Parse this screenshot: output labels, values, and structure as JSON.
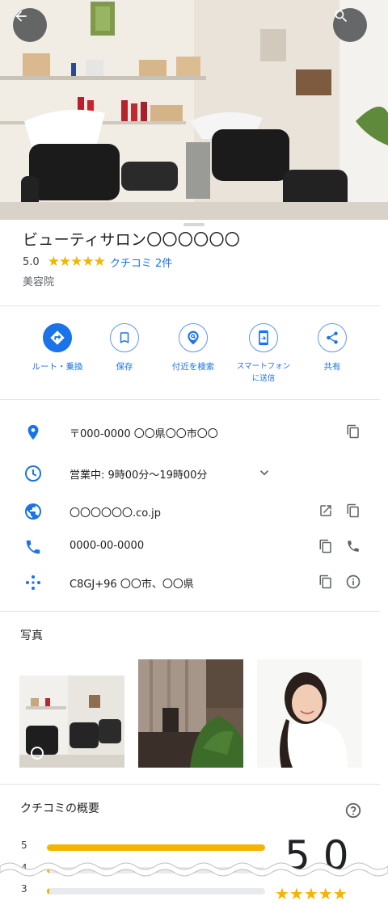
{
  "place": {
    "name": "ビューティサロン〇〇〇〇〇〇",
    "rating": "5.0",
    "stars": "★★★★★",
    "review_link": "クチコミ 2件",
    "category": "美容院"
  },
  "actions": [
    {
      "label": "ルート・乗換",
      "icon": "directions-icon"
    },
    {
      "label": "保存",
      "icon": "bookmark-icon"
    },
    {
      "label": "付近を検索",
      "icon": "nearby-search-icon"
    },
    {
      "label": "スマートフォン\nに送信",
      "icon": "send-to-phone-icon"
    },
    {
      "label": "共有",
      "icon": "share-icon"
    }
  ],
  "info": {
    "address": "〒000-0000 〇〇県〇〇市〇〇",
    "hours": "営業中:  9時00分～19時00分",
    "website": "〇〇〇〇〇〇.co.jp",
    "phone": "0000-00-0000",
    "plus_code": "C8GJ+96 〇〇市、〇〇県"
  },
  "photos": {
    "title": "写真"
  },
  "reviews": {
    "title": "クチコミの概要",
    "score": "5.0",
    "stars": "★★★★★",
    "bars": [
      {
        "label": "5",
        "fraction": 1.0
      },
      {
        "label": "4",
        "fraction": 0.0
      },
      {
        "label": "3",
        "fraction": 0.0
      }
    ]
  },
  "colors": {
    "accent": "#1a73e8",
    "star": "#f4b400"
  }
}
